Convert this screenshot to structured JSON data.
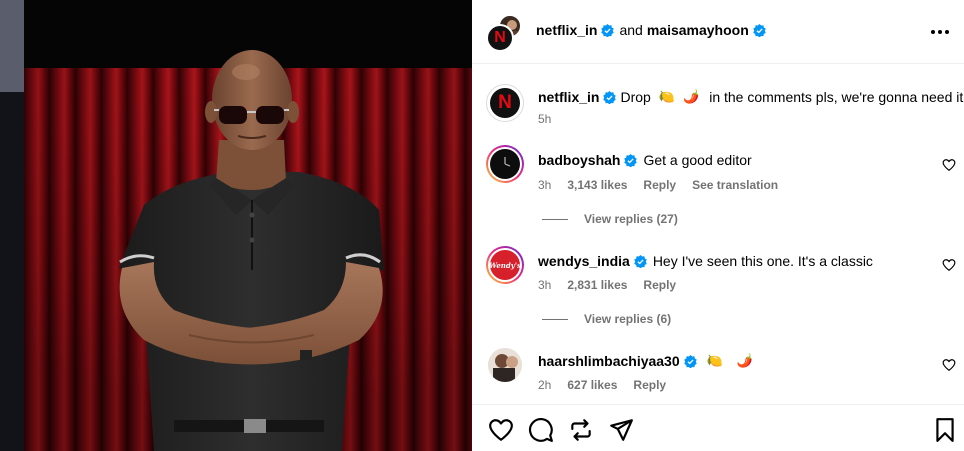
{
  "header": {
    "user1": "netflix_in",
    "conjunction": "and",
    "user2": "maisamayhoon",
    "more_icon": "more-horizontal-icon"
  },
  "caption": {
    "username": "netflix_in",
    "text_before": "Drop",
    "emoji1": "🍋",
    "emoji2": "🌶️",
    "text_after": "in the comments pls, we're gonna need it",
    "time": "5h"
  },
  "comments": [
    {
      "username": "badboyshah",
      "text": "Get a good editor",
      "time": "3h",
      "likes": "3,143 likes",
      "reply": "Reply",
      "translate": "See translation",
      "view_replies": "View replies (27)"
    },
    {
      "username": "wendys_india",
      "text": "Hey I've seen this one. It's a classic",
      "time": "3h",
      "likes": "2,831 likes",
      "reply": "Reply",
      "view_replies": "View replies (6)"
    },
    {
      "username": "haarshlimbachiyaa30",
      "emoji1": "🍋",
      "emoji2": "🌶️",
      "time": "2h",
      "likes": "627 likes",
      "reply": "Reply"
    }
  ],
  "avatar_text": {
    "netflix": "N",
    "wendys": "Wendy's"
  },
  "footer": {
    "icons": [
      "heart-icon",
      "comment-icon",
      "repost-icon",
      "share-icon",
      "bookmark-icon"
    ]
  },
  "colors": {
    "verified": "#0095f6",
    "netflix_red": "#e50914",
    "wendys_red": "#d6202b",
    "meta_gray": "#737373"
  }
}
